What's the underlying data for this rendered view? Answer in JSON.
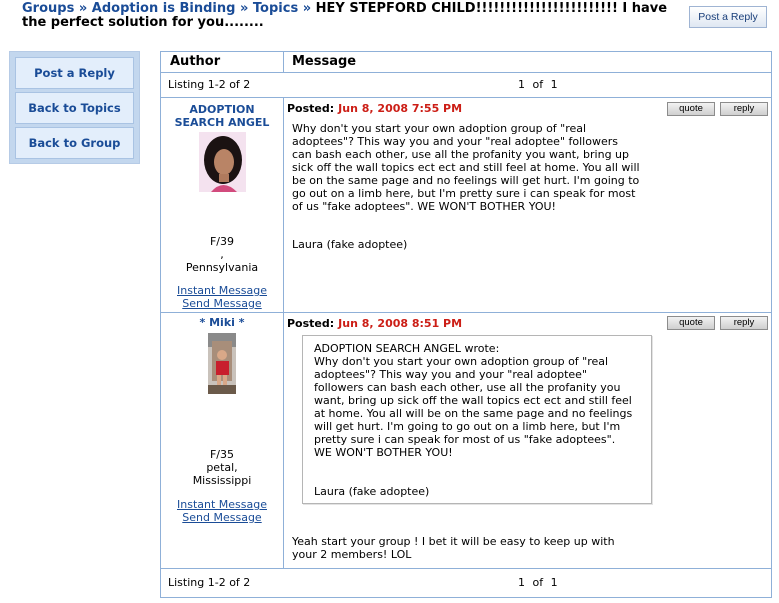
{
  "breadcrumb": {
    "groups": "Groups",
    "sep1": "»",
    "group": "Adoption is Binding",
    "sep2": "»",
    "topics": "Topics",
    "sep3": "»",
    "title": "HEY STEPFORD CHILD!!!!!!!!!!!!!!!!!!!!!!!! I have the perfect solution for you........"
  },
  "top_button": "Post a Reply",
  "sidebar": {
    "post_reply": "Post a Reply",
    "back_topics": "Back to Topics",
    "back_group": "Back to Group"
  },
  "table": {
    "col_author": "Author",
    "col_message": "Message",
    "listing": "Listing 1-2 of 2",
    "pager": "1  of  1"
  },
  "posts": [
    {
      "author_line1": "ADOPTION",
      "author_line2": "SEARCH ANGEL",
      "meta_age": "F/39",
      "meta_city": ",",
      "meta_region": "Pennsylvania",
      "im": "Instant Message",
      "send": "Send Message",
      "posted_label": "Posted:",
      "posted_date": "Jun 8, 2008 7:55 PM",
      "quote_btn": "quote",
      "reply_btn": "reply",
      "body": [
        "Why don't you start your own adoption group of \"real",
        "adoptees\"? This way you and your \"real adoptee\" followers",
        "can bash each other, use all the profanity you want, bring up",
        "sick off the wall topics ect ect and still feel at home. You all will",
        "be on the same page and no feelings will get hurt. I'm going to",
        "go out on a limb here, but I'm pretty sure i can speak for most",
        "of us \"fake adoptees\". WE WON'T BOTHER YOU!"
      ],
      "signature": "Laura (fake adoptee)"
    },
    {
      "author_line1": "* Miki *",
      "meta_age": "F/35",
      "meta_city": "petal,",
      "meta_region": "Mississippi",
      "im": "Instant Message",
      "send": "Send Message",
      "posted_label": "Posted:",
      "posted_date": "Jun 8, 2008 8:51 PM",
      "quote_btn": "quote",
      "reply_btn": "reply",
      "quote": [
        "ADOPTION SEARCH ANGEL wrote:",
        "Why don't you start your own adoption group of \"real",
        "adoptees\"? This way you and your \"real adoptee\"",
        "followers can bash each other, use all the profanity you",
        "want, bring up sick off the wall topics ect ect and still feel",
        "at home. You all will be on the same page and no feelings",
        "will get hurt. I'm going to go out on a limb here, but I'm",
        "pretty sure i can speak for most of us \"fake adoptees\".",
        "WE WON'T BOTHER YOU!"
      ],
      "quote_signature": "Laura (fake adoptee)",
      "body": [
        "Yeah start your group ! I bet it will be easy to keep up with",
        "your 2 members! LOL"
      ]
    }
  ]
}
